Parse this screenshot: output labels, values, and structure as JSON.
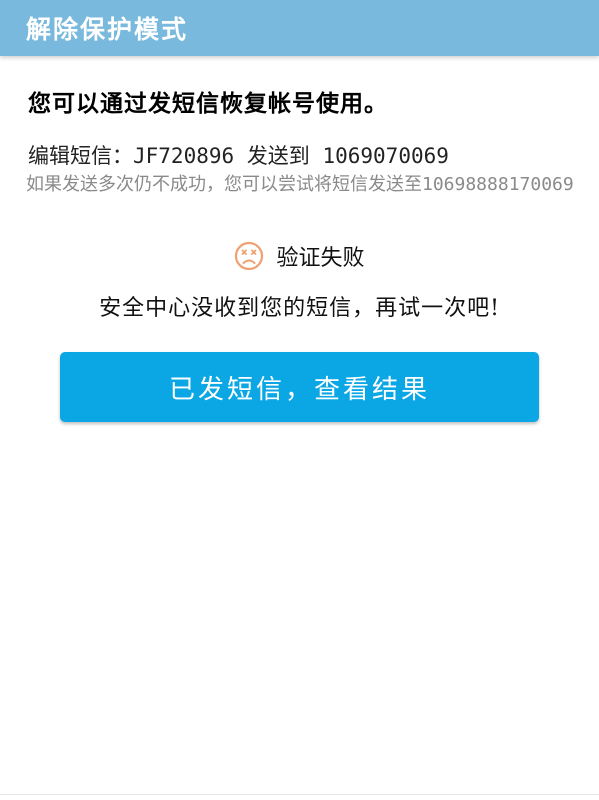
{
  "header": {
    "title": "解除保护模式"
  },
  "content": {
    "headline": "您可以通过发短信恢复帐号使用。",
    "sms_prefix": "编辑短信：",
    "sms_code": "JF720896",
    "sms_send_to": "发送到",
    "sms_number": "1069070069",
    "alt_instruction": "如果发送多次仍不成功，您可以尝试将短信发送至10698888170069"
  },
  "status": {
    "icon": "sad-face-icon",
    "text": "验证失败",
    "icon_color": "#f0a070"
  },
  "message": "安全中心没收到您的短信，再试一次吧!",
  "button": {
    "label": "已发短信，查看结果",
    "color": "#0aa7e4"
  },
  "colors": {
    "title_bar": "#78b9dd",
    "background": "#ffffff"
  }
}
